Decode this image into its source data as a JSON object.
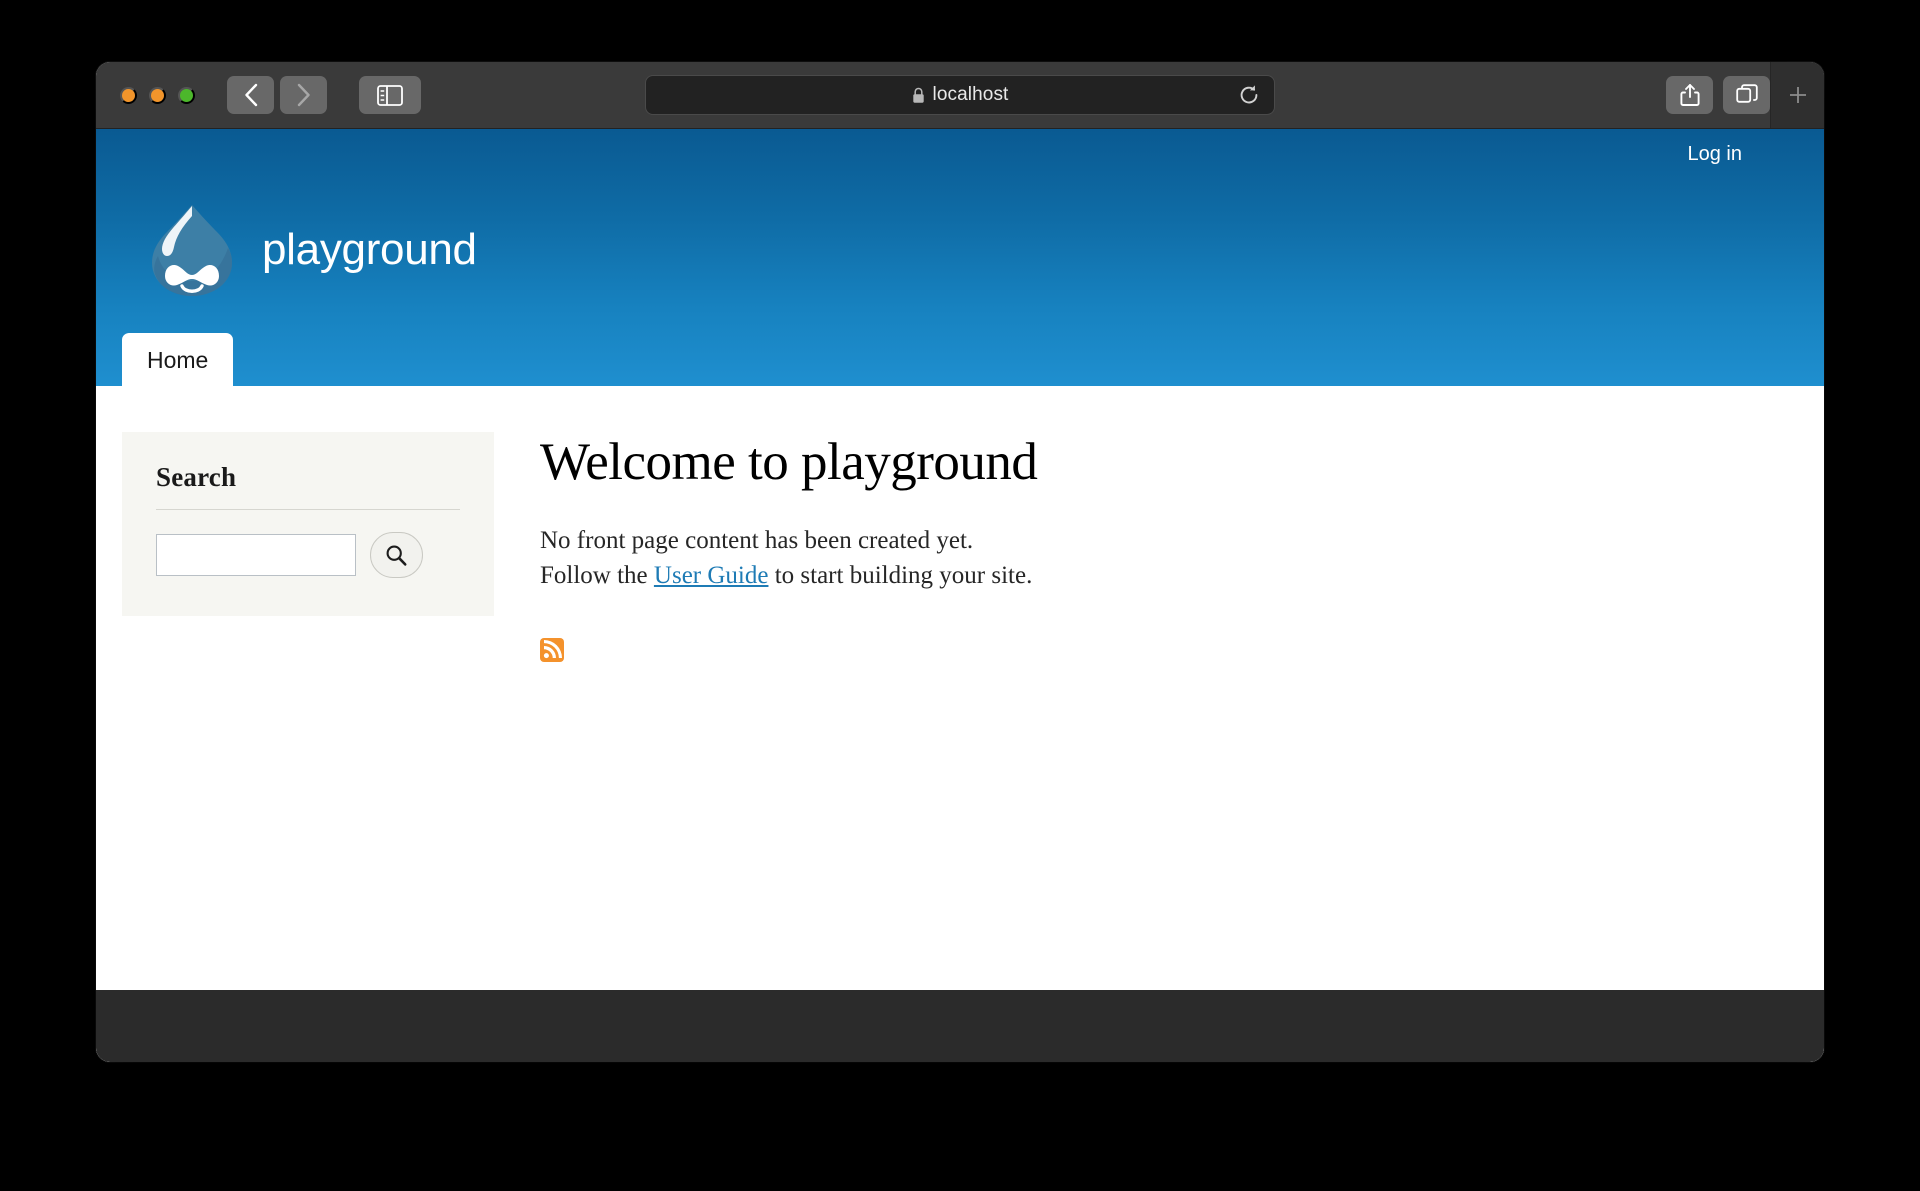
{
  "browser": {
    "window_controls": [
      {
        "name": "close",
        "color": "#f2952b"
      },
      {
        "name": "minimize",
        "color": "#f2952b"
      },
      {
        "name": "maximize",
        "color": "#4cb72b"
      }
    ],
    "back_label": "Back",
    "forward_label": "Forward",
    "sidebar_label": "Show sidebar",
    "url": "localhost",
    "lock_label": "Secure connection",
    "reload_label": "Reload this page",
    "share_label": "Share",
    "tabs_label": "Show tab overview",
    "new_tab_label": "+"
  },
  "site": {
    "name": "playground",
    "logo_name": "drupal-droplet-logo",
    "login_label": "Log in",
    "nav": [
      {
        "label": "Home",
        "active": true
      }
    ]
  },
  "sidebar": {
    "search_block": {
      "title": "Search",
      "input_value": "",
      "input_placeholder": "",
      "submit_label": "Search"
    }
  },
  "main": {
    "title": "Welcome to playground",
    "body_line_1": "No front page content has been created yet.",
    "body_line_2_before": "Follow the ",
    "body_link": "User Guide",
    "body_line_2_after": " to start building your site.",
    "feed_icon_name": "rss-feed-icon",
    "feed_icon_color": "#f4922c"
  },
  "theme": {
    "header_gradient_top": "#0a5a92",
    "header_gradient_bottom": "#1f8fcf",
    "link_color": "#1e7bb5",
    "block_bg": "#f6f6f2",
    "footer_bg": "#2b2b2b",
    "toolbar_bg": "#3a3a3a"
  }
}
